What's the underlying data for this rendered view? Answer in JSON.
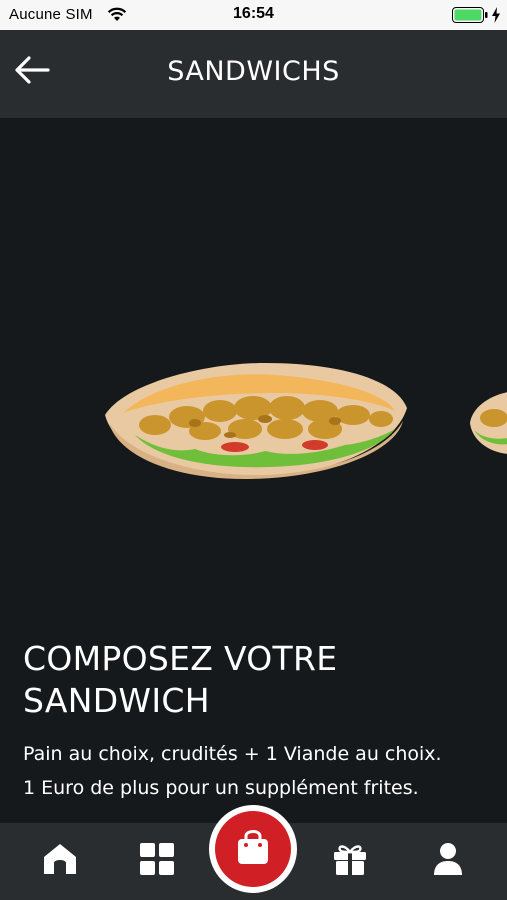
{
  "status_bar": {
    "carrier": "Aucune SIM",
    "time": "16:54"
  },
  "header": {
    "title": "SANDWICHS",
    "back_icon": "arrow-left-icon"
  },
  "product": {
    "title": "COMPOSEZ VOTRE SANDWICH",
    "description_line1": "Pain au choix, crudités + 1 Viande au choix.",
    "description_line2": "1 Euro de plus pour un supplément frites."
  },
  "tab_bar": {
    "items": [
      {
        "icon": "home-icon"
      },
      {
        "icon": "categories-icon"
      },
      {
        "icon": "shopping-bag-icon"
      },
      {
        "icon": "gift-icon"
      },
      {
        "icon": "user-icon"
      }
    ]
  },
  "colors": {
    "background": "#16191b",
    "bar": "#2a2d30",
    "accent": "#d01f25",
    "battery": "#4cd964"
  }
}
